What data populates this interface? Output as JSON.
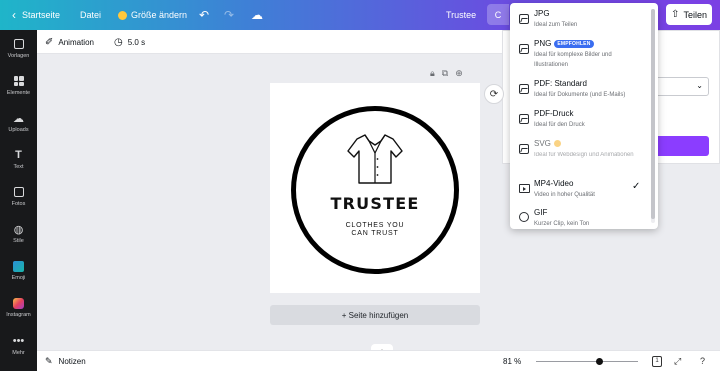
{
  "topbar": {
    "home_label": "Startseite",
    "file_label": "Datei",
    "resize_label": "Größe ändern",
    "title": "Trustee",
    "download_label": "C",
    "share_label": "Teilen"
  },
  "sidebar": {
    "items": [
      {
        "label": "Vorlagen",
        "icon": "templates-icon"
      },
      {
        "label": "Elemente",
        "icon": "elements-icon"
      },
      {
        "label": "Uploads",
        "icon": "upload-icon"
      },
      {
        "label": "Text",
        "icon": "text-icon"
      },
      {
        "label": "Fotos",
        "icon": "photo-icon"
      },
      {
        "label": "Stile",
        "icon": "styles-icon"
      },
      {
        "label": "Emoji",
        "icon": "emoji-icon"
      },
      {
        "label": "Instagram",
        "icon": "instagram-icon"
      },
      {
        "label": "Mehr",
        "icon": "more-icon"
      }
    ]
  },
  "toolbar": {
    "animation_label": "Animation",
    "duration_label": "5.0 s"
  },
  "design": {
    "brand": "TRUSTEE",
    "tagline_1": "CLOTHES YOU",
    "tagline_2": "CAN TRUST"
  },
  "add_page_label": "+ Seite hinzufügen",
  "bottombar": {
    "notes_label": "Notizen",
    "zoom_label": "81 %",
    "zoom_percent": 81,
    "page_indicator": "1"
  },
  "dropdown": {
    "items": [
      {
        "title": "JPG",
        "desc": "Ideal zum Teilen",
        "badge": "",
        "selected": false
      },
      {
        "title": "PNG",
        "desc": "Ideal für komplexe Bilder und Illustrationen",
        "badge": "EMPFOHLEN",
        "selected": false
      },
      {
        "title": "PDF: Standard",
        "desc": "Ideal für Dokumente (und E-Mails)",
        "badge": "",
        "selected": false
      },
      {
        "title": "PDF-Druck",
        "desc": "Ideal für den Druck",
        "badge": "",
        "selected": false
      },
      {
        "title": "SVG",
        "desc": "Ideal für Webdesign und Animationen",
        "badge": "",
        "selected": false
      },
      {
        "title": "MP4-Video",
        "desc": "Video in hoher Qualität",
        "badge": "",
        "selected": true
      },
      {
        "title": "GIF",
        "desc": "Kurzer Clip, kein Ton",
        "badge": "",
        "selected": false
      }
    ]
  },
  "colors": {
    "accent_purple": "#8b3dff",
    "badge_blue": "#3a6df0",
    "sidebar_bg": "#18191b"
  }
}
